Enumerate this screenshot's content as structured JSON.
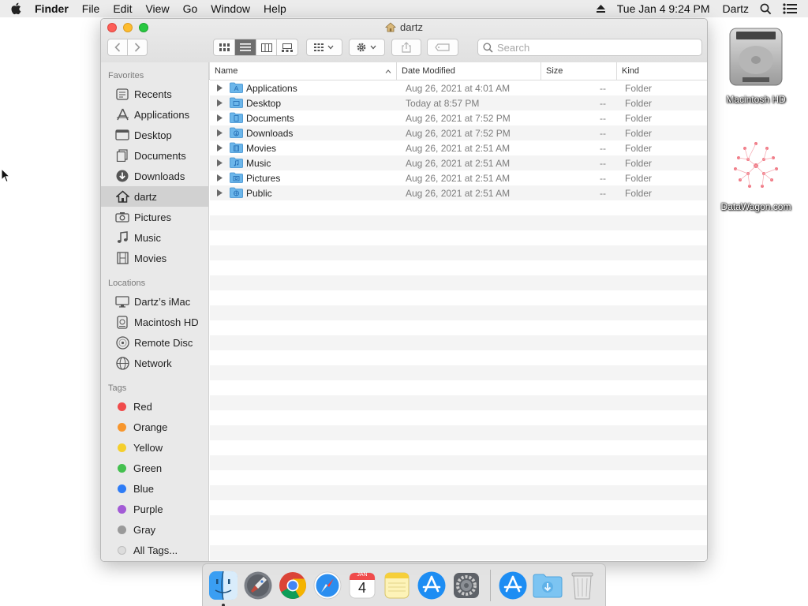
{
  "menubar": {
    "app": "Finder",
    "items": [
      "File",
      "Edit",
      "View",
      "Go",
      "Window",
      "Help"
    ],
    "clock": "Tue Jan 4  9:24 PM",
    "user": "Dartz"
  },
  "desktop": {
    "icons": [
      {
        "label": "Macintosh HD",
        "icon": "hard-drive-icon"
      },
      {
        "label": "DataWagon.com",
        "icon": "datawagon-logo-icon"
      }
    ]
  },
  "window": {
    "title": "dartz",
    "search_placeholder": "Search",
    "sidebar": {
      "favorites_header": "Favorites",
      "favorites": [
        "Recents",
        "Applications",
        "Desktop",
        "Documents",
        "Downloads",
        "dartz",
        "Pictures",
        "Music",
        "Movies"
      ],
      "selected": "dartz",
      "locations_header": "Locations",
      "locations": [
        "Dartz’s iMac",
        "Macintosh HD",
        "Remote Disc",
        "Network"
      ],
      "tags_header": "Tags",
      "tags": [
        {
          "label": "Red",
          "color": "#f04b4b"
        },
        {
          "label": "Orange",
          "color": "#f7962d"
        },
        {
          "label": "Yellow",
          "color": "#f5cf2c"
        },
        {
          "label": "Green",
          "color": "#44c04f"
        },
        {
          "label": "Blue",
          "color": "#2e7cf6"
        },
        {
          "label": "Purple",
          "color": "#a35bd6"
        },
        {
          "label": "Gray",
          "color": "#9a9a9a"
        }
      ],
      "all_tags": "All Tags..."
    },
    "columns": {
      "name": "Name",
      "date": "Date Modified",
      "size": "Size",
      "kind": "Kind"
    },
    "files": [
      {
        "name": "Applications",
        "date": "Aug 26, 2021 at 4:01 AM",
        "size": "--",
        "kind": "Folder"
      },
      {
        "name": "Desktop",
        "date": "Today at 8:57 PM",
        "size": "--",
        "kind": "Folder"
      },
      {
        "name": "Documents",
        "date": "Aug 26, 2021 at 7:52 PM",
        "size": "--",
        "kind": "Folder"
      },
      {
        "name": "Downloads",
        "date": "Aug 26, 2021 at 7:52 PM",
        "size": "--",
        "kind": "Folder"
      },
      {
        "name": "Movies",
        "date": "Aug 26, 2021 at 2:51 AM",
        "size": "--",
        "kind": "Folder"
      },
      {
        "name": "Music",
        "date": "Aug 26, 2021 at 2:51 AM",
        "size": "--",
        "kind": "Folder"
      },
      {
        "name": "Pictures",
        "date": "Aug 26, 2021 at 2:51 AM",
        "size": "--",
        "kind": "Folder"
      },
      {
        "name": "Public",
        "date": "Aug 26, 2021 at 2:51 AM",
        "size": "--",
        "kind": "Folder"
      }
    ]
  },
  "dock": {
    "items": [
      "finder-icon",
      "launchpad-icon",
      "chrome-icon",
      "safari-icon",
      "calendar-icon",
      "notes-icon",
      "app-store-icon",
      "system-preferences-icon",
      "app-store-folder-icon",
      "downloads-folder-icon",
      "trash-icon"
    ],
    "calendar_month": "JAN",
    "calendar_day": "4"
  }
}
